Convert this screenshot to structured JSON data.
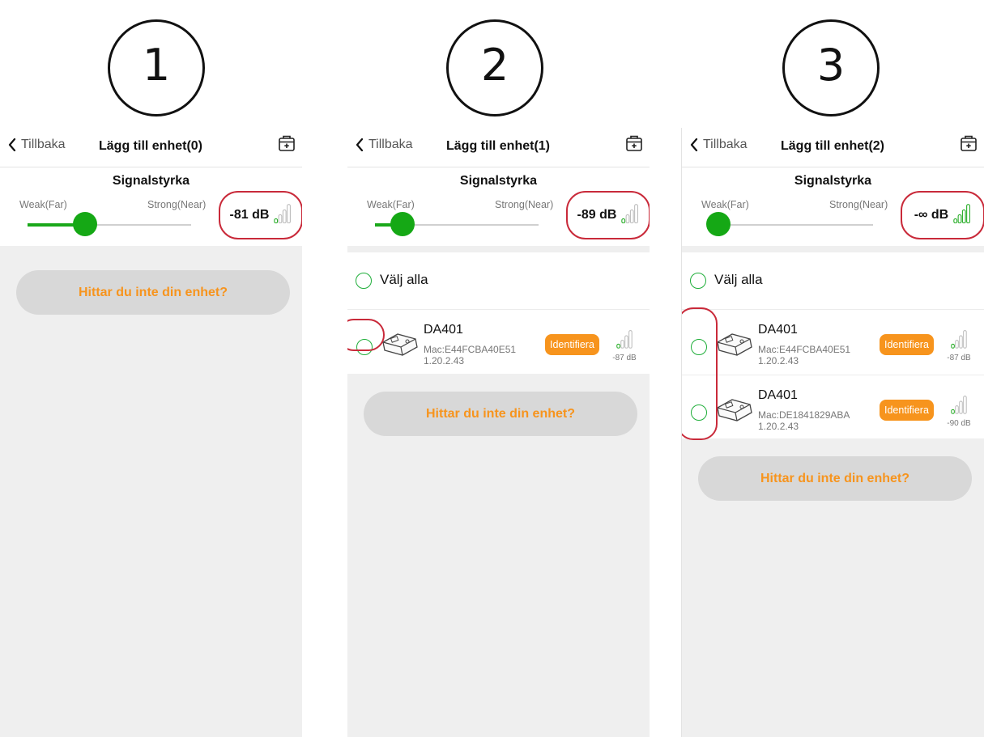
{
  "steps": [
    "1",
    "2",
    "3"
  ],
  "common": {
    "back_label": "Tillbaka",
    "signal_title": "Signalstyrka",
    "weak_label": "Weak(Far)",
    "strong_label": "Strong(Near)",
    "select_all_label": "Välj alla",
    "not_found_label": "Hittar du inte din enhet?",
    "identify_label": "Identifiera",
    "colors": {
      "accent_green": "#15a815",
      "orange": "#f7941d",
      "highlight_red": "#c92a3a",
      "background_grey": "#efefef"
    },
    "icons": {
      "back": "chevron-left-icon",
      "add": "add-device-icon",
      "signal": "signal-bars-icon",
      "device": "device-image"
    }
  },
  "panels": [
    {
      "title": "Lägg till enhet(0)",
      "db_value": "-81 dB",
      "slider_level": 0.35,
      "signal_bars_active": 1,
      "devices": []
    },
    {
      "title": "Lägg till enhet(1)",
      "db_value": "-89 dB",
      "slider_level": 0.17,
      "signal_bars_active": 1,
      "devices": [
        {
          "name": "DA401",
          "mac": "Mac:E44FCBA40E51",
          "version": "1.20.2.43",
          "rssi": "-87 dB",
          "bars_active": 1
        }
      ]
    },
    {
      "title": "Lägg till enhet(2)",
      "db_value": "-∞ dB",
      "slider_level": 0.0,
      "signal_bars_active": 4,
      "devices": [
        {
          "name": "DA401",
          "mac": "Mac:E44FCBA40E51",
          "version": "1.20.2.43",
          "rssi": "-87 dB",
          "bars_active": 1
        },
        {
          "name": "DA401",
          "mac": "Mac:DE1841829ABA",
          "version": "1.20.2.43",
          "rssi": "-90 dB",
          "bars_active": 1
        }
      ]
    }
  ]
}
